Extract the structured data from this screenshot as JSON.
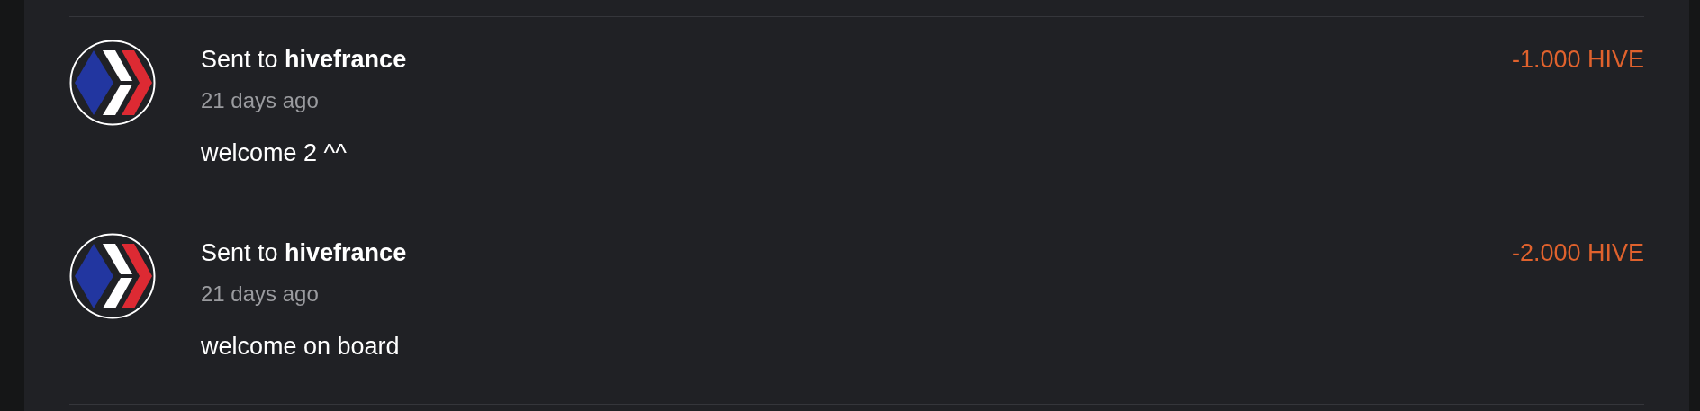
{
  "transactions": [
    {
      "title": "Sent to **hivefrance**",
      "time": "21 days ago",
      "memo": "welcome 2 ^^",
      "amount": "-1.000 HIVE"
    },
    {
      "title": "Sent to **hivefrance**",
      "time": "21 days ago",
      "memo": "welcome on board",
      "amount": "-2.000 HIVE"
    }
  ]
}
